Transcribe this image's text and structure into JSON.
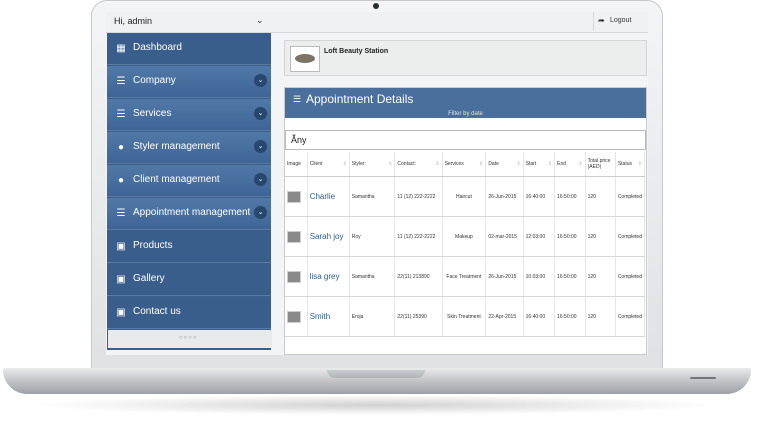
{
  "topbar": {
    "greeting": "Hi, admin",
    "logout": "Logout"
  },
  "sidebar": {
    "items": [
      {
        "label": "Dashboard",
        "icon": "grid-icon",
        "expandable": false
      },
      {
        "label": "Company",
        "icon": "list-icon",
        "expandable": true
      },
      {
        "label": "Services",
        "icon": "list-icon",
        "expandable": true
      },
      {
        "label": "Styler management",
        "icon": "user-icon",
        "expandable": true
      },
      {
        "label": "Client management",
        "icon": "user-icon",
        "expandable": true
      },
      {
        "label": "Appointment management",
        "icon": "list-icon",
        "expandable": true
      },
      {
        "label": "Products",
        "icon": "image-icon",
        "expandable": false
      },
      {
        "label": "Gallery",
        "icon": "image-icon",
        "expandable": false
      },
      {
        "label": "Contact us",
        "icon": "image-icon",
        "expandable": false
      }
    ]
  },
  "company": {
    "name": "Loft Beauty Station"
  },
  "panel": {
    "title": "Appointment Details",
    "filter_label": "Filter by date",
    "filter_value": "Any",
    "columns": [
      "Image",
      "Client",
      "Styler:",
      "Contact:",
      "Services",
      "Date",
      "Start",
      "End",
      "Total price (AED)",
      "Status"
    ],
    "rows": [
      {
        "client": "Charlie",
        "styler": "Samantha",
        "contact": "11 (12) 222-2222",
        "service": "Haircut",
        "date": "26-Jun-2015",
        "start": "16:40:00",
        "end": "16:50:00",
        "price": "120",
        "status": "Completed"
      },
      {
        "client": "Sarah joy",
        "styler": "Roy",
        "contact": "11 (12) 222-2222",
        "service": "Makeup",
        "date": "02-mar-2015",
        "start": "12:03:00",
        "end": "16:50:00",
        "price": "120",
        "status": "Completed"
      },
      {
        "client": "lisa grey",
        "styler": "Samantha",
        "contact": "22(11) 213890",
        "service": "Face Treatment",
        "date": "26-Jun-2015",
        "start": "10:03:00",
        "end": "16:50:00",
        "price": "120",
        "status": "Completed"
      },
      {
        "client": "Smith",
        "styler": "Eroja",
        "contact": "22(11) 25390",
        "service": "Skin Treatment",
        "date": "22-Apr-2015",
        "start": "16:40:00",
        "end": "16:50:00",
        "price": "120",
        "status": "Completed"
      }
    ]
  },
  "colors": {
    "sidebar": "#3b5f8c",
    "panel_header": "#4a6f9d",
    "link": "#2f5e93"
  }
}
